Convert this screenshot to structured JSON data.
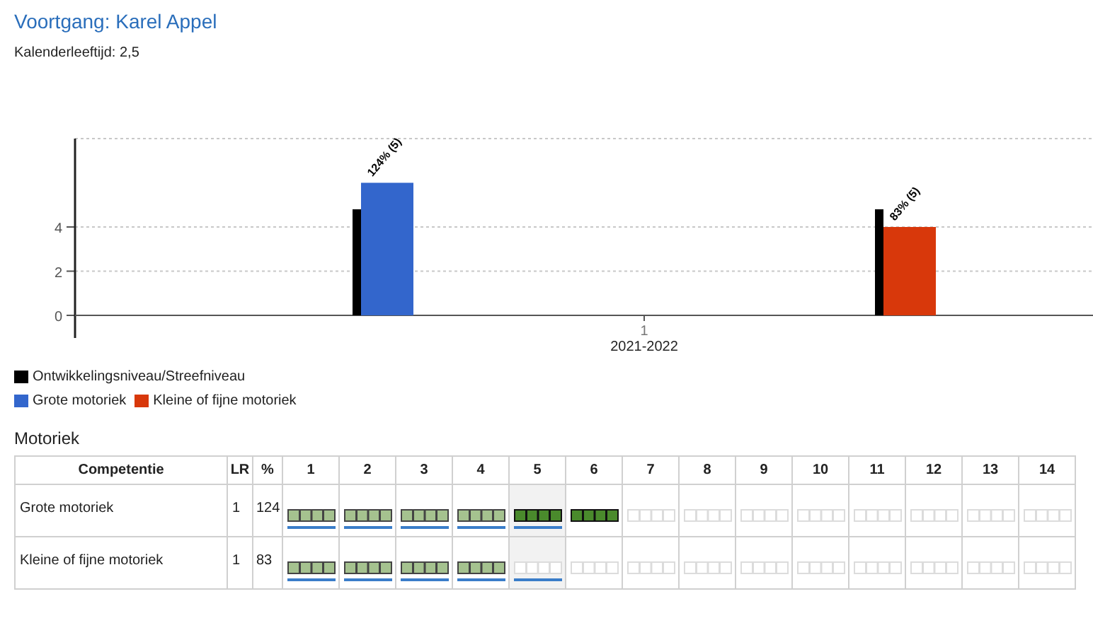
{
  "title": "Voortgang: Karel Appel",
  "subtitle": "Kalenderleeftijd: 2,5",
  "chart": {
    "tick_label": "1",
    "chart_data": {
      "type": "bar",
      "xlabel": "2021-2022",
      "ylim": [
        0,
        8
      ],
      "yticks": [
        {
          "value": 0,
          "label": "0"
        },
        {
          "value": 2,
          "label": "2"
        },
        {
          "value": 4,
          "label": "4"
        }
      ],
      "series": [
        {
          "name": "Ontwikkelingsniveau/Streefniveau",
          "color": "#000000",
          "values": [
            4.8,
            4.8
          ]
        },
        {
          "name": "Grote motoriek",
          "color": "#3366cc",
          "values": [
            6,
            null
          ]
        },
        {
          "name": "Kleine of fijne motoriek",
          "color": "#d8380b",
          "values": [
            null,
            4
          ]
        }
      ],
      "value_labels": [
        "124% (5)",
        "83% (5)"
      ],
      "legend": true
    }
  },
  "section_title": "Motoriek",
  "table": {
    "columns": [
      "Competentie",
      "LR",
      "%",
      "1",
      "2",
      "3",
      "4",
      "5",
      "6",
      "7",
      "8",
      "9",
      "10",
      "11",
      "12",
      "13",
      "14"
    ],
    "rows": [
      {
        "name": "Grote motoriek",
        "lr": "1",
        "percent": "124",
        "levels": [
          {
            "kind": "achieved",
            "underlined": true,
            "highlighted": false
          },
          {
            "kind": "achieved",
            "underlined": true,
            "highlighted": false
          },
          {
            "kind": "achieved",
            "underlined": true,
            "highlighted": false
          },
          {
            "kind": "achieved",
            "underlined": true,
            "highlighted": false
          },
          {
            "kind": "current",
            "underlined": true,
            "highlighted": true
          },
          {
            "kind": "current",
            "underlined": false,
            "highlighted": false
          },
          {
            "kind": "empty",
            "underlined": false,
            "highlighted": false
          },
          {
            "kind": "empty",
            "underlined": false,
            "highlighted": false
          },
          {
            "kind": "empty",
            "underlined": false,
            "highlighted": false
          },
          {
            "kind": "empty",
            "underlined": false,
            "highlighted": false
          },
          {
            "kind": "empty",
            "underlined": false,
            "highlighted": false
          },
          {
            "kind": "empty",
            "underlined": false,
            "highlighted": false
          },
          {
            "kind": "empty",
            "underlined": false,
            "highlighted": false
          },
          {
            "kind": "empty",
            "underlined": false,
            "highlighted": false
          }
        ]
      },
      {
        "name": "Kleine of fijne motoriek",
        "lr": "1",
        "percent": "83",
        "levels": [
          {
            "kind": "achieved",
            "underlined": true,
            "highlighted": false
          },
          {
            "kind": "achieved",
            "underlined": true,
            "highlighted": false
          },
          {
            "kind": "achieved",
            "underlined": true,
            "highlighted": false
          },
          {
            "kind": "achieved",
            "underlined": true,
            "highlighted": false
          },
          {
            "kind": "empty",
            "underlined": true,
            "highlighted": true
          },
          {
            "kind": "empty",
            "underlined": false,
            "highlighted": false
          },
          {
            "kind": "empty",
            "underlined": false,
            "highlighted": false
          },
          {
            "kind": "empty",
            "underlined": false,
            "highlighted": false
          },
          {
            "kind": "empty",
            "underlined": false,
            "highlighted": false
          },
          {
            "kind": "empty",
            "underlined": false,
            "highlighted": false
          },
          {
            "kind": "empty",
            "underlined": false,
            "highlighted": false
          },
          {
            "kind": "empty",
            "underlined": false,
            "highlighted": false
          },
          {
            "kind": "empty",
            "underlined": false,
            "highlighted": false
          },
          {
            "kind": "empty",
            "underlined": false,
            "highlighted": false
          }
        ]
      }
    ]
  }
}
